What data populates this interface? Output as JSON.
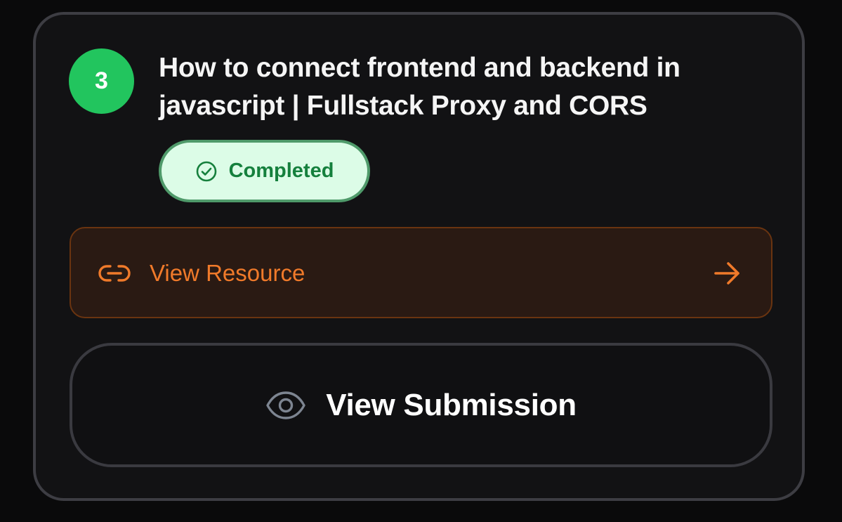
{
  "task": {
    "step_number": "3",
    "title": "How to connect frontend and backend in javascript | Fullstack Proxy and CORS",
    "status": {
      "label": "Completed",
      "icon": "check-circle-icon",
      "color": "#15803d",
      "background": "#dcfce7"
    }
  },
  "actions": {
    "resource": {
      "label": "View Resource",
      "icon": "link-icon",
      "trailing_icon": "arrow-right-icon",
      "color": "#f07a2a"
    },
    "submission": {
      "label": "View Submission",
      "icon": "eye-icon"
    }
  },
  "colors": {
    "accent_green": "#22c55e",
    "accent_orange": "#f07a2a",
    "card_background": "#121214",
    "page_background": "#0a0a0b"
  }
}
